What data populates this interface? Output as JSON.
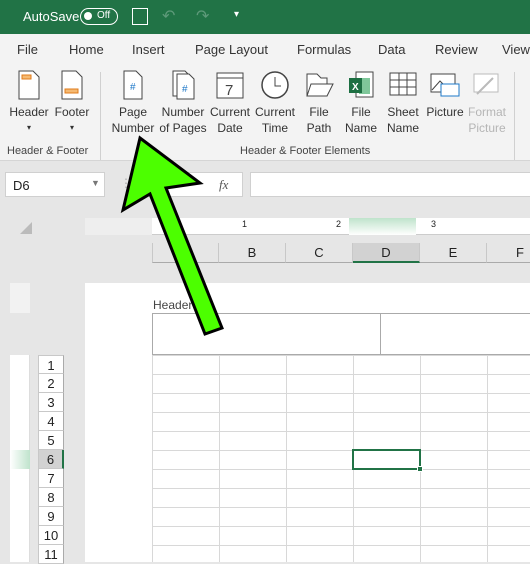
{
  "titlebar": {
    "autosave": "AutoSave",
    "toggle": "Off"
  },
  "tabs": [
    "File",
    "Home",
    "Insert",
    "Page Layout",
    "Formulas",
    "Data",
    "Review",
    "View"
  ],
  "ribbon": {
    "hf": [
      {
        "l1": "Header",
        "l2": ""
      },
      {
        "l1": "Footer",
        "l2": ""
      }
    ],
    "hf_group": "Header & Footer",
    "elements": [
      {
        "l1": "Page",
        "l2": "Number"
      },
      {
        "l1": "Number",
        "l2": "of Pages"
      },
      {
        "l1": "Current",
        "l2": "Date"
      },
      {
        "l1": "Current",
        "l2": "Time"
      },
      {
        "l1": "File",
        "l2": "Path"
      },
      {
        "l1": "File",
        "l2": "Name"
      },
      {
        "l1": "Sheet",
        "l2": "Name"
      },
      {
        "l1": "Picture",
        "l2": ""
      },
      {
        "l1": "Format",
        "l2": "Picture"
      }
    ],
    "elements_group": "Header & Footer Elements",
    "date_num": "7"
  },
  "formula": {
    "namebox": "D6",
    "fx": "fx",
    "value": ""
  },
  "ruler": [
    "1",
    "2",
    "3"
  ],
  "columns": [
    "",
    "B",
    "C",
    "D",
    "E",
    "F"
  ],
  "header_label": "Header",
  "rows": [
    "1",
    "2",
    "3",
    "4",
    "5",
    "6",
    "7",
    "8",
    "9",
    "10",
    "11"
  ],
  "selected_cell": "D6",
  "accent": "#217346",
  "arrow_color": "#4cff00"
}
